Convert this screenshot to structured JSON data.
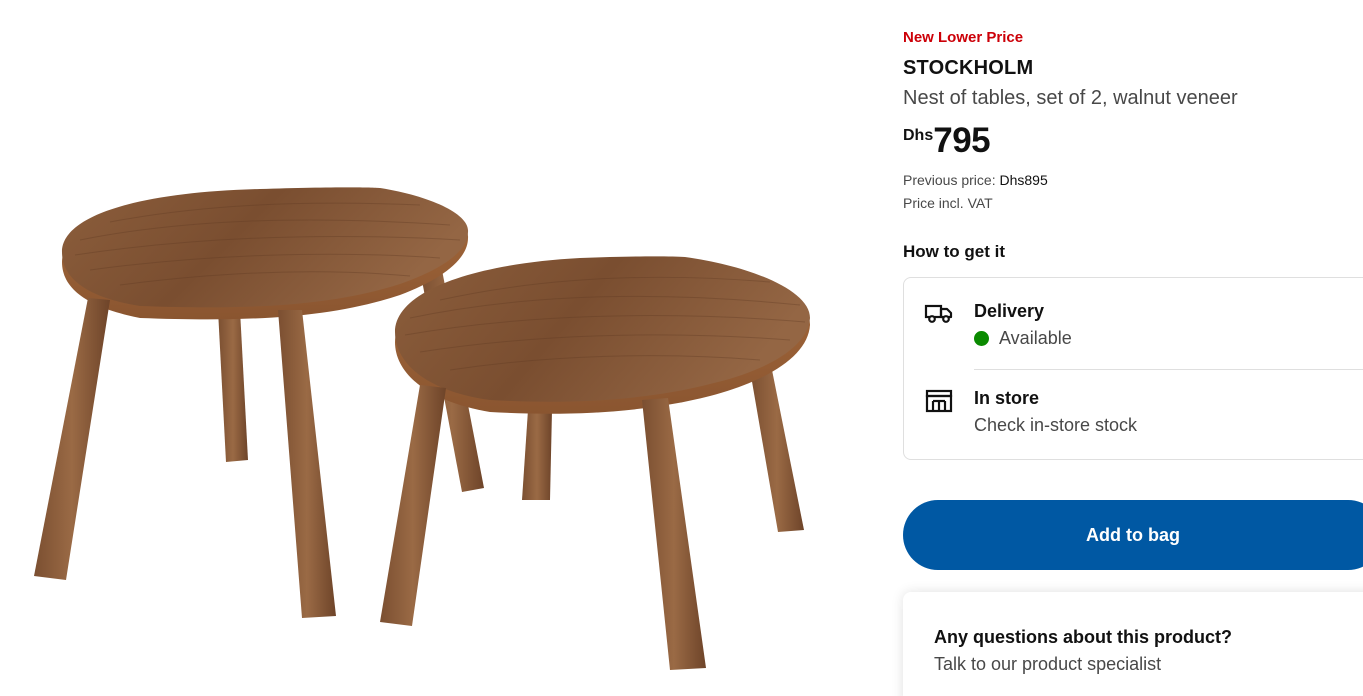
{
  "product": {
    "badge": "New Lower Price",
    "name": "STOCKHOLM",
    "description": "Nest of tables, set of 2, walnut veneer",
    "price_currency": "Dhs",
    "price_value": "795",
    "previous_price_label": "Previous price: ",
    "previous_price_amount": "Dhs895",
    "vat_note": "Price incl. VAT",
    "image_icon": "nest-of-tables-image"
  },
  "how_to_get": {
    "title": "How to get it",
    "delivery": {
      "icon": "truck-icon",
      "title": "Delivery",
      "status": "Available",
      "status_color": "#0a8a00"
    },
    "store": {
      "icon": "store-icon",
      "title": "In store",
      "action": "Check in-store stock"
    }
  },
  "actions": {
    "add_to_bag": "Add to bag",
    "button_color": "#0058a3"
  },
  "questions": {
    "title": "Any questions about this product?",
    "subtitle": "Talk to our product specialist"
  },
  "colors": {
    "badge": "#cc0008",
    "wood": "#8a5a37"
  }
}
